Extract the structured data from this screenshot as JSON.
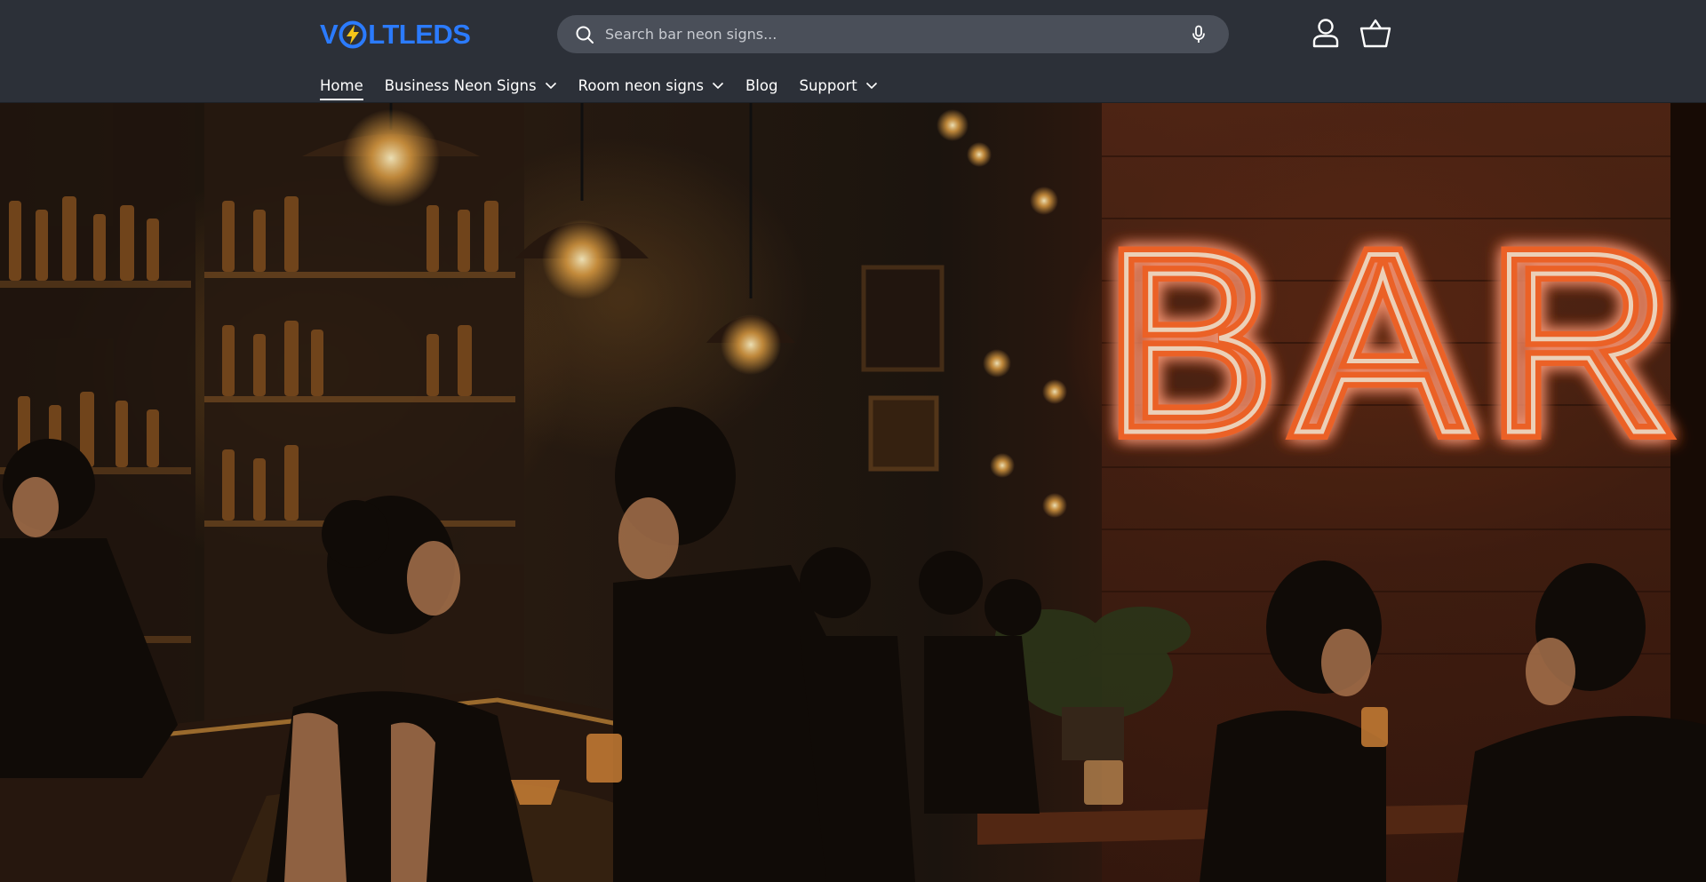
{
  "brand": {
    "logo_pre": "V",
    "logo_post": "LTLEDS",
    "color": "#2b7bff",
    "accent": "#f5c518"
  },
  "search": {
    "placeholder": "Search bar neon signs..."
  },
  "header_icons": {
    "account": "account-icon",
    "cart": "basket-icon"
  },
  "nav": {
    "items": [
      {
        "label": "Home",
        "active": true,
        "dropdown": false
      },
      {
        "label": "Business Neon Signs",
        "active": false,
        "dropdown": true
      },
      {
        "label": "Room neon signs",
        "active": false,
        "dropdown": true
      },
      {
        "label": "Blog",
        "active": false,
        "dropdown": false
      },
      {
        "label": "Support",
        "active": false,
        "dropdown": true
      }
    ]
  },
  "hero": {
    "sign_text": "BAR",
    "neon_color": "#ff6a2a"
  }
}
